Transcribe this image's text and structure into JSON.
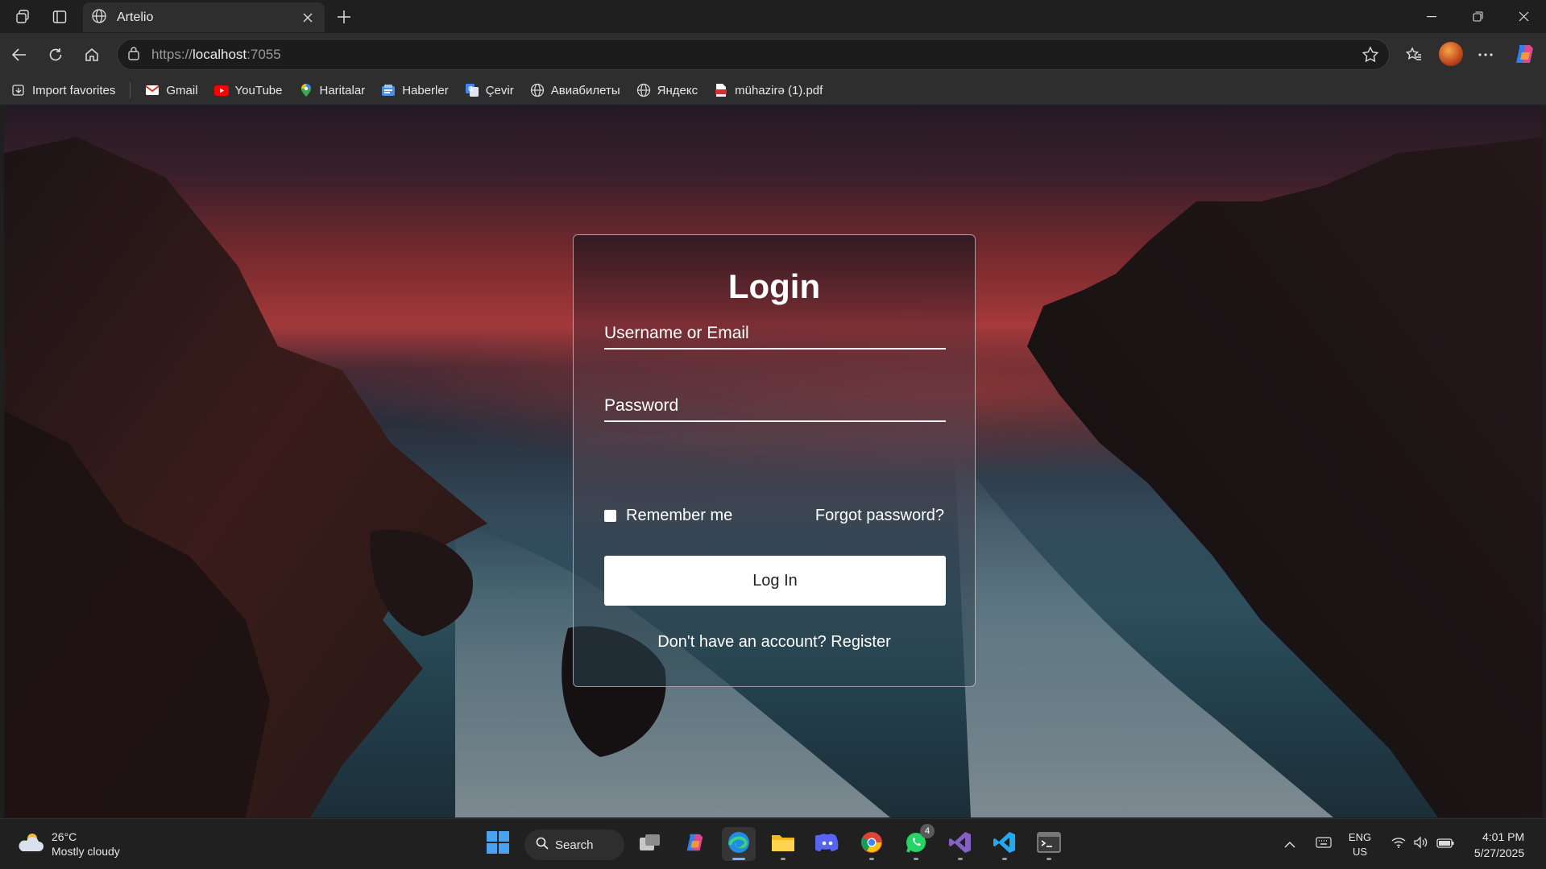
{
  "browser": {
    "tab": {
      "title": "Artelio"
    },
    "address": {
      "scheme": "https://",
      "host": "localhost",
      "port": ":7055"
    },
    "bookmarks": [
      {
        "label": "Import favorites",
        "icon": "import-icon"
      },
      {
        "label": "Gmail",
        "icon": "gmail-icon"
      },
      {
        "label": "YouTube",
        "icon": "youtube-icon"
      },
      {
        "label": "Haritalar",
        "icon": "maps-icon"
      },
      {
        "label": "Haberler",
        "icon": "news-icon"
      },
      {
        "label": "Çevir",
        "icon": "translate-icon"
      },
      {
        "label": "Авиабилеты",
        "icon": "globe-icon"
      },
      {
        "label": "Яндекс",
        "icon": "globe-icon"
      },
      {
        "label": "mühazirə (1).pdf",
        "icon": "pdf-icon"
      }
    ]
  },
  "login": {
    "title": "Login",
    "username_placeholder": "Username or Email",
    "password_placeholder": "Password",
    "remember_label": "Remember me",
    "forgot_label": "Forgot password?",
    "submit_label": "Log In",
    "register_prompt": "Don't have an account? Register"
  },
  "taskbar": {
    "weather": {
      "temp": "26°C",
      "condition": "Mostly cloudy"
    },
    "search_label": "Search",
    "whatsapp_badge": "4",
    "language": {
      "line1": "ENG",
      "line2": "US"
    },
    "clock": {
      "time": "4:01 PM",
      "date": "5/27/2025"
    }
  },
  "colors": {
    "accent": "#7fb0ff",
    "card_border": "#ffffff",
    "button_bg": "#ffffff"
  }
}
